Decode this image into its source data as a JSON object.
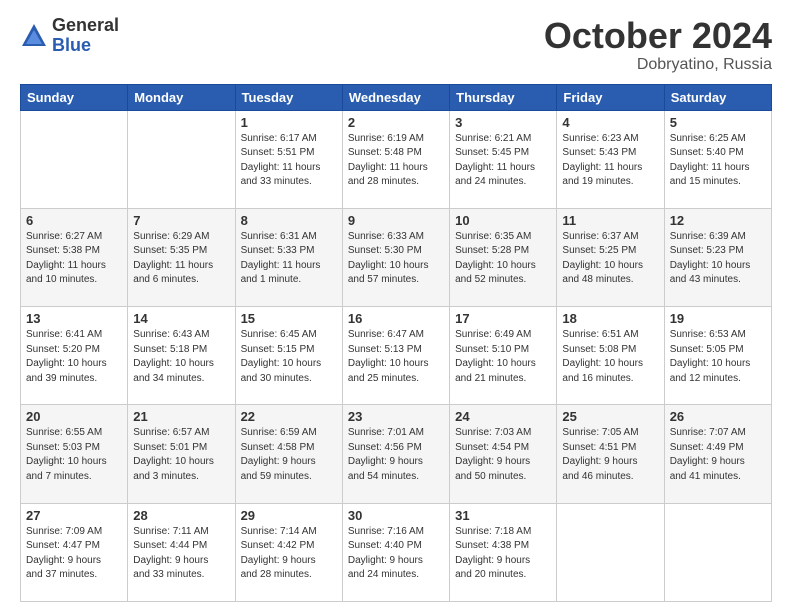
{
  "logo": {
    "general": "General",
    "blue": "Blue"
  },
  "header": {
    "month": "October 2024",
    "location": "Dobryatino, Russia"
  },
  "weekdays": [
    "Sunday",
    "Monday",
    "Tuesday",
    "Wednesday",
    "Thursday",
    "Friday",
    "Saturday"
  ],
  "weeks": [
    [
      {
        "day": "",
        "info": ""
      },
      {
        "day": "",
        "info": ""
      },
      {
        "day": "1",
        "info": "Sunrise: 6:17 AM\nSunset: 5:51 PM\nDaylight: 11 hours\nand 33 minutes."
      },
      {
        "day": "2",
        "info": "Sunrise: 6:19 AM\nSunset: 5:48 PM\nDaylight: 11 hours\nand 28 minutes."
      },
      {
        "day": "3",
        "info": "Sunrise: 6:21 AM\nSunset: 5:45 PM\nDaylight: 11 hours\nand 24 minutes."
      },
      {
        "day": "4",
        "info": "Sunrise: 6:23 AM\nSunset: 5:43 PM\nDaylight: 11 hours\nand 19 minutes."
      },
      {
        "day": "5",
        "info": "Sunrise: 6:25 AM\nSunset: 5:40 PM\nDaylight: 11 hours\nand 15 minutes."
      }
    ],
    [
      {
        "day": "6",
        "info": "Sunrise: 6:27 AM\nSunset: 5:38 PM\nDaylight: 11 hours\nand 10 minutes."
      },
      {
        "day": "7",
        "info": "Sunrise: 6:29 AM\nSunset: 5:35 PM\nDaylight: 11 hours\nand 6 minutes."
      },
      {
        "day": "8",
        "info": "Sunrise: 6:31 AM\nSunset: 5:33 PM\nDaylight: 11 hours\nand 1 minute."
      },
      {
        "day": "9",
        "info": "Sunrise: 6:33 AM\nSunset: 5:30 PM\nDaylight: 10 hours\nand 57 minutes."
      },
      {
        "day": "10",
        "info": "Sunrise: 6:35 AM\nSunset: 5:28 PM\nDaylight: 10 hours\nand 52 minutes."
      },
      {
        "day": "11",
        "info": "Sunrise: 6:37 AM\nSunset: 5:25 PM\nDaylight: 10 hours\nand 48 minutes."
      },
      {
        "day": "12",
        "info": "Sunrise: 6:39 AM\nSunset: 5:23 PM\nDaylight: 10 hours\nand 43 minutes."
      }
    ],
    [
      {
        "day": "13",
        "info": "Sunrise: 6:41 AM\nSunset: 5:20 PM\nDaylight: 10 hours\nand 39 minutes."
      },
      {
        "day": "14",
        "info": "Sunrise: 6:43 AM\nSunset: 5:18 PM\nDaylight: 10 hours\nand 34 minutes."
      },
      {
        "day": "15",
        "info": "Sunrise: 6:45 AM\nSunset: 5:15 PM\nDaylight: 10 hours\nand 30 minutes."
      },
      {
        "day": "16",
        "info": "Sunrise: 6:47 AM\nSunset: 5:13 PM\nDaylight: 10 hours\nand 25 minutes."
      },
      {
        "day": "17",
        "info": "Sunrise: 6:49 AM\nSunset: 5:10 PM\nDaylight: 10 hours\nand 21 minutes."
      },
      {
        "day": "18",
        "info": "Sunrise: 6:51 AM\nSunset: 5:08 PM\nDaylight: 10 hours\nand 16 minutes."
      },
      {
        "day": "19",
        "info": "Sunrise: 6:53 AM\nSunset: 5:05 PM\nDaylight: 10 hours\nand 12 minutes."
      }
    ],
    [
      {
        "day": "20",
        "info": "Sunrise: 6:55 AM\nSunset: 5:03 PM\nDaylight: 10 hours\nand 7 minutes."
      },
      {
        "day": "21",
        "info": "Sunrise: 6:57 AM\nSunset: 5:01 PM\nDaylight: 10 hours\nand 3 minutes."
      },
      {
        "day": "22",
        "info": "Sunrise: 6:59 AM\nSunset: 4:58 PM\nDaylight: 9 hours\nand 59 minutes."
      },
      {
        "day": "23",
        "info": "Sunrise: 7:01 AM\nSunset: 4:56 PM\nDaylight: 9 hours\nand 54 minutes."
      },
      {
        "day": "24",
        "info": "Sunrise: 7:03 AM\nSunset: 4:54 PM\nDaylight: 9 hours\nand 50 minutes."
      },
      {
        "day": "25",
        "info": "Sunrise: 7:05 AM\nSunset: 4:51 PM\nDaylight: 9 hours\nand 46 minutes."
      },
      {
        "day": "26",
        "info": "Sunrise: 7:07 AM\nSunset: 4:49 PM\nDaylight: 9 hours\nand 41 minutes."
      }
    ],
    [
      {
        "day": "27",
        "info": "Sunrise: 7:09 AM\nSunset: 4:47 PM\nDaylight: 9 hours\nand 37 minutes."
      },
      {
        "day": "28",
        "info": "Sunrise: 7:11 AM\nSunset: 4:44 PM\nDaylight: 9 hours\nand 33 minutes."
      },
      {
        "day": "29",
        "info": "Sunrise: 7:14 AM\nSunset: 4:42 PM\nDaylight: 9 hours\nand 28 minutes."
      },
      {
        "day": "30",
        "info": "Sunrise: 7:16 AM\nSunset: 4:40 PM\nDaylight: 9 hours\nand 24 minutes."
      },
      {
        "day": "31",
        "info": "Sunrise: 7:18 AM\nSunset: 4:38 PM\nDaylight: 9 hours\nand 20 minutes."
      },
      {
        "day": "",
        "info": ""
      },
      {
        "day": "",
        "info": ""
      }
    ]
  ]
}
